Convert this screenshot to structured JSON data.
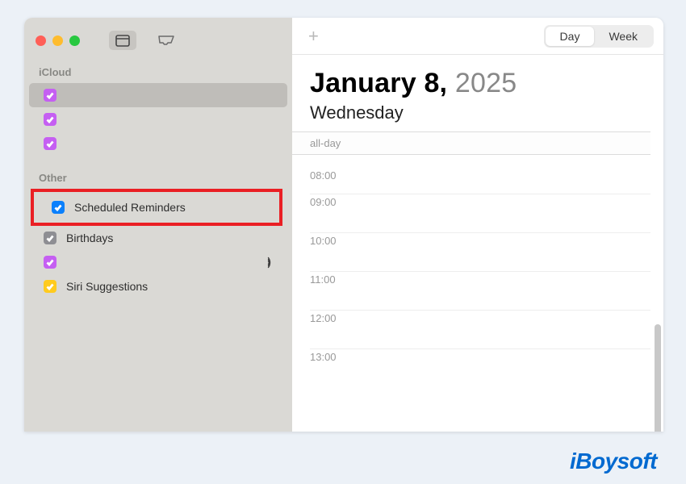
{
  "sidebar": {
    "sections": [
      {
        "label": "iCloud",
        "items": [
          {
            "color": "purple",
            "label": "",
            "selected": true
          },
          {
            "color": "purple",
            "label": ""
          },
          {
            "color": "purple",
            "label": ""
          }
        ]
      },
      {
        "label": "Other",
        "items": [
          {
            "color": "blue",
            "label": "Scheduled Reminders",
            "highlighted": true
          },
          {
            "color": "gray",
            "label": "Birthdays"
          },
          {
            "color": "purple",
            "label": "",
            "broadcast": true
          },
          {
            "color": "yellowchk",
            "label": "Siri Suggestions"
          }
        ]
      }
    ]
  },
  "main": {
    "view": {
      "day": "Day",
      "week": "Week"
    },
    "date": {
      "month_day": "January 8,",
      "year": "2025",
      "dayname": "Wednesday"
    },
    "allday_label": "all-day",
    "hours": [
      "08:00",
      "09:00",
      "10:00",
      "11:00",
      "12:00",
      "13:00"
    ]
  },
  "watermark": "iBoysoft"
}
